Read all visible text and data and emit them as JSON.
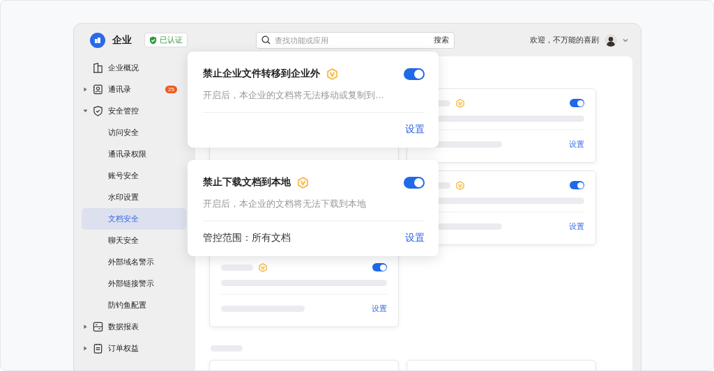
{
  "header": {
    "org_name": "企业",
    "verified_badge": "已认证",
    "search": {
      "placeholder": "查找功能或应用",
      "button": "搜索"
    },
    "greeting": "欢迎，不万能的喜剧"
  },
  "sidebar": {
    "items": [
      {
        "label": "企业概况",
        "kind": "leaf",
        "selected": false
      },
      {
        "label": "通讯录",
        "kind": "group",
        "expanded": false,
        "selected": false,
        "badge": "25"
      },
      {
        "label": "安全管控",
        "kind": "group",
        "expanded": true,
        "selected": false,
        "children": [
          {
            "label": "访问安全",
            "selected": false
          },
          {
            "label": "通讯录权限",
            "selected": false
          },
          {
            "label": "账号安全",
            "selected": false
          },
          {
            "label": "水印设置",
            "selected": false
          },
          {
            "label": "文档安全",
            "selected": true
          },
          {
            "label": "聊天安全",
            "selected": false
          },
          {
            "label": "外部域名警示",
            "selected": false
          },
          {
            "label": "外部链接警示",
            "selected": false
          },
          {
            "label": "防钓鱼配置",
            "selected": false
          }
        ]
      },
      {
        "label": "数据报表",
        "kind": "group",
        "expanded": false,
        "selected": false
      },
      {
        "label": "订单权益",
        "kind": "group",
        "expanded": false,
        "selected": false
      }
    ]
  },
  "placeholder_cards": [
    {
      "on": true,
      "link": "设置"
    },
    {
      "on": true,
      "link": "设置"
    },
    {
      "on": true,
      "link": "设置"
    }
  ],
  "feature_cards": [
    {
      "title": "禁止企业文件转移到企业外",
      "description": "开启后，本企业的文档将无法移动或复制到…",
      "on": true,
      "link": "设置"
    },
    {
      "title": "禁止下载文档到本地",
      "description": "开启后，本企业的文档将无法下载到本地",
      "scope": "管控范围：所有文档",
      "on": true,
      "link": "设置"
    }
  ]
}
